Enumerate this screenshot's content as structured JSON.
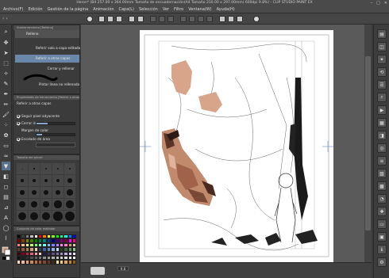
{
  "window": {
    "title": "Heron* (B4 257.00 x 364.00mm Tamaño de encuadernación(A4 Tamaño 210.00 x 297.00mm) 600dpi 9.8%) - CLIP STUDIO PAINT EX",
    "minimize": "–",
    "maximize": "□",
    "close": "✕"
  },
  "menu": [
    "Archivo(F)",
    "Edición",
    "Gestión de la página",
    "Animación",
    "Capa(L)",
    "Selección",
    "Ver",
    "Filtro",
    "Ventana(W)",
    "Ayuda(H)"
  ],
  "subtool_panel": {
    "title": "Subherramienta [Relleno]",
    "items": [
      "Relleno",
      "Referir solo a capa editada",
      "Referir a otras capas",
      "Cerrar y rellenar",
      "Pintar línea no rellenada"
    ]
  },
  "tool_property": {
    "title": "Propiedades de herramienta [Referir a otras capas]",
    "heading": "Referir a otras capas",
    "follow_adjacent": "Seguir píxel adyacente",
    "close_gap": "Cerrar intervalo",
    "color_margin": "Margen de color",
    "area_scaling": "Escalado de área"
  },
  "brush_size": {
    "title": "Tamaño del pincel"
  },
  "color_set": {
    "title": "Conjunto de color estándar",
    "colors": [
      "#000000",
      "#3f3f3f",
      "#7f7f7f",
      "#bfbfbf",
      "#ffffff",
      "#ff0000",
      "#ff7f00",
      "#ffff00",
      "#7fff00",
      "#00ff00",
      "#00ff7f",
      "#00ffff",
      "#007fff",
      "#0000ff",
      "#7f0000",
      "#7f3f00",
      "#7f7f00",
      "#3f7f00",
      "#007f00",
      "#007f3f",
      "#007f7f",
      "#003f7f",
      "#00007f",
      "#3f007f",
      "#7f007f",
      "#7f003f",
      "#ff00ff",
      "#ff007f",
      "#ff7f7f",
      "#ffbf7f",
      "#ffff7f",
      "#bfff7f",
      "#7fff7f",
      "#7fffbf",
      "#7fffff",
      "#7fbfff",
      "#7f7fff",
      "#bf7fff",
      "#ff7fff",
      "#ff7fbf",
      "#c8a07a",
      "#e8c8a8",
      "#5a3a2a",
      "#8a5a3a",
      "#b07a50",
      "#d0a080",
      "#f0d0b0",
      "#304060",
      "#4060a0",
      "#6080c0",
      "#90b0e0",
      "#c0d8f0",
      "#204020",
      "#406040",
      "#609060",
      "#90c090",
      "#400000",
      "#800020",
      "#c02040",
      "#e06080",
      "#f0a0b0",
      "#f8d0d8",
      "#202040",
      "#403060",
      "#605080",
      "#8070a0",
      "#a090c0",
      "#c0b0e0",
      "#e0d0f0",
      "#f0e8f8",
      "#101010",
      "#202020",
      "#303030",
      "#505050",
      "#606060",
      "#707070",
      "#909090",
      "#a0a0a0",
      "#b0b0b0",
      "#c0c0c0",
      "#d0d0d0",
      "#e0e0e0",
      "#f0f0f0",
      "#fafafa",
      "#ffd8c0",
      "#f0b8a0",
      "#e0a080",
      "#d08860",
      "#c07048",
      "#a05838",
      "#804830",
      "#603828",
      "#402820",
      "#f8e0b0",
      "#f0c880",
      "#e0a850",
      "#c08830",
      "#906020"
    ]
  },
  "status_bar": {
    "zoom": "9.8"
  },
  "colors": {
    "selected_item": "#6a86a8",
    "skin_tone": "#d9a58a"
  }
}
